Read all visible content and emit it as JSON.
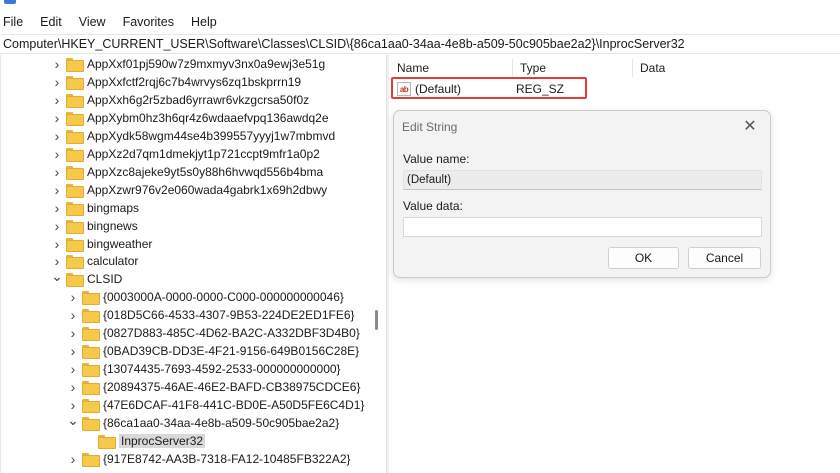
{
  "menu": [
    "File",
    "Edit",
    "View",
    "Favorites",
    "Help"
  ],
  "address": "Computer\\HKEY_CURRENT_USER\\Software\\Classes\\CLSID\\{86ca1aa0-34aa-4e8b-a509-50c905bae2a2}\\InprocServer32",
  "tree": {
    "items": [
      {
        "label": "AppXxf01pj590w7z9mxmyv3nx0a9ewj3e51g",
        "expanded": false
      },
      {
        "label": "AppXxfctf2rqj6c7b4wrvys6zq1bskprrn19",
        "expanded": false
      },
      {
        "label": "AppXxh6g2r5zbad6yrrawr6vkzgcrsa50f0z",
        "expanded": false
      },
      {
        "label": "AppXybm0hz3h6qr4z6wdaaefvpq136awdq2e",
        "expanded": false
      },
      {
        "label": "AppXydk58wgm44se4b399557yyyj1w7mbmvd",
        "expanded": false
      },
      {
        "label": "AppXz2d7qm1dmekjyt1p721ccpt9mfr1a0p2",
        "expanded": false
      },
      {
        "label": "AppXzc8ajeke9yt5s0y88h6hvwqd556b4bma",
        "expanded": false
      },
      {
        "label": "AppXzwr976v2e060wada4gabrk1x69h2dbwy",
        "expanded": false
      },
      {
        "label": "bingmaps",
        "expanded": false
      },
      {
        "label": "bingnews",
        "expanded": false
      },
      {
        "label": "bingweather",
        "expanded": false
      },
      {
        "label": "calculator",
        "expanded": false
      },
      {
        "label": "CLSID",
        "expanded": true
      },
      {
        "label": "{0003000A-0000-0000-C000-000000000046}",
        "expanded": false
      },
      {
        "label": "{018D5C66-4533-4307-9B53-224DE2ED1FE6}",
        "expanded": false
      },
      {
        "label": "{0827D883-485C-4D62-BA2C-A332DBF3D4B0}",
        "expanded": false
      },
      {
        "label": "{0BAD39CB-DD3E-4F21-9156-649B0156C28E}",
        "expanded": false
      },
      {
        "label": "{13074435-7693-4592-2533-000000000000}",
        "expanded": false
      },
      {
        "label": "{20894375-46AE-46E2-BAFD-CB38975CDCE6}",
        "expanded": false
      },
      {
        "label": "{47E6DCAF-41F8-441C-BD0E-A50D5FE6C4D1}",
        "expanded": false
      },
      {
        "label": "{86ca1aa0-34aa-4e8b-a509-50c905bae2a2}",
        "expanded": true
      },
      {
        "label": "InprocServer32",
        "expanded": false,
        "selected": true
      },
      {
        "label": "{917E8742-AA3B-7318-FA12-10485FB322A2}",
        "expanded": false
      }
    ]
  },
  "list": {
    "headers": [
      "Name",
      "Type",
      "Data"
    ],
    "rows": [
      {
        "icon": "ab",
        "name": "(Default)",
        "type": "REG_SZ",
        "data": ""
      }
    ]
  },
  "dialog": {
    "title": "Edit String",
    "value_name_label": "Value name:",
    "value_name": "(Default)",
    "value_data_label": "Value data:",
    "value_data": "",
    "ok": "OK",
    "cancel": "Cancel"
  },
  "colors": {
    "highlight": "#e53935",
    "folder": "#f6c94a"
  }
}
